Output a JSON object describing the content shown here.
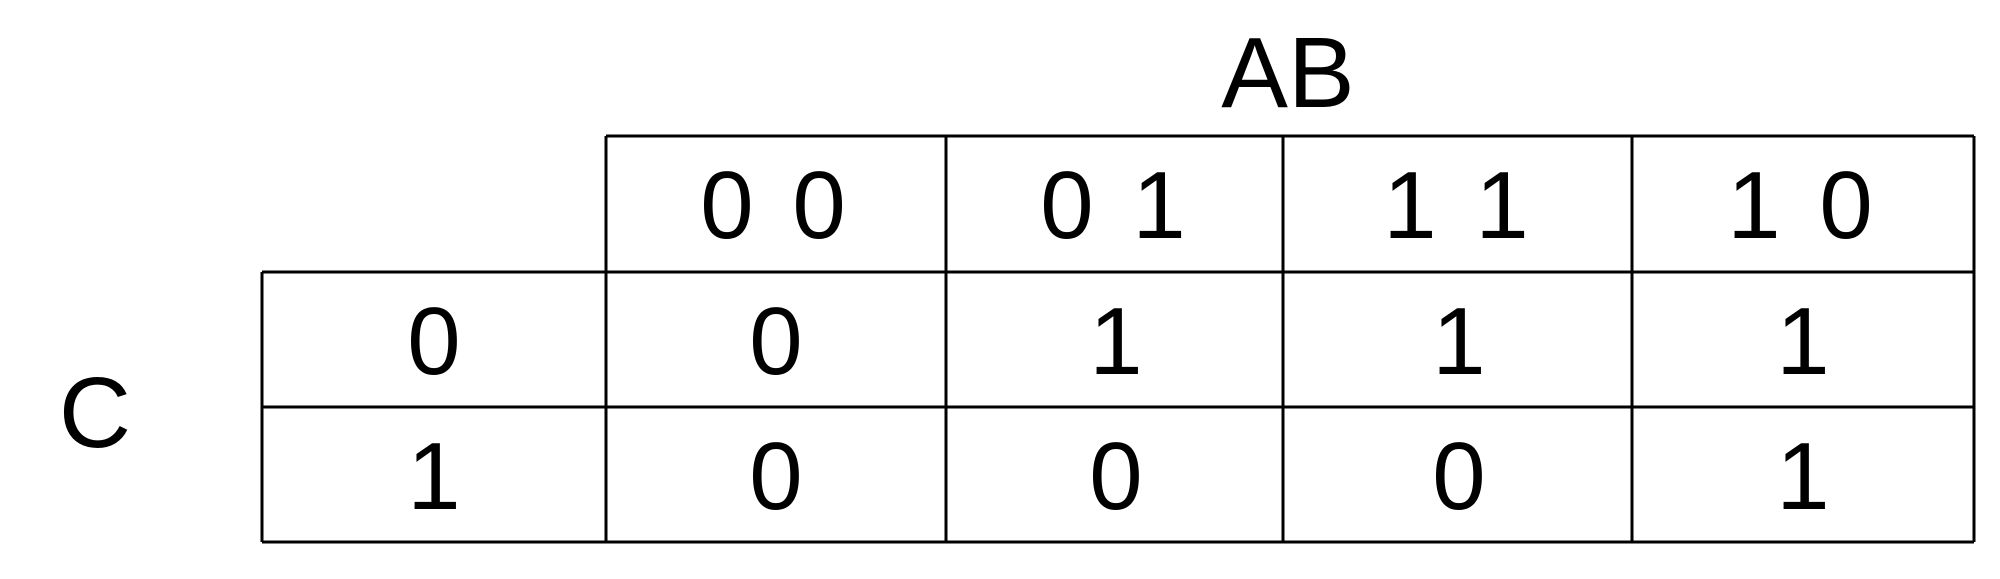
{
  "variables": {
    "column_vars": "AB",
    "row_vars": "C"
  },
  "column_headers": [
    "0 0",
    "0 1",
    "1 1",
    "1 0"
  ],
  "row_headers": [
    "0",
    "1"
  ],
  "cells": [
    [
      "0",
      "1",
      "1",
      "1"
    ],
    [
      "0",
      "0",
      "0",
      "1"
    ]
  ],
  "colors": {
    "lines": "#000000",
    "text": "#000000",
    "background": "#ffffff"
  }
}
